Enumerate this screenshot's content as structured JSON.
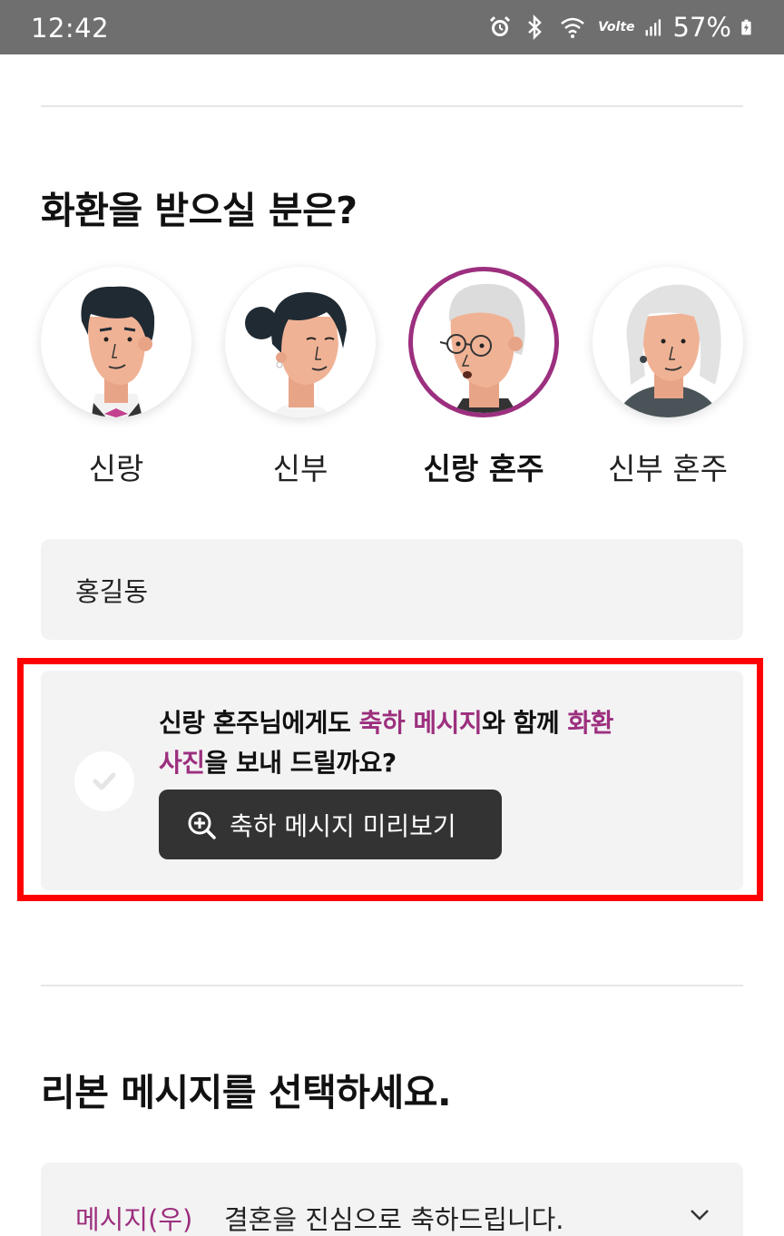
{
  "status_bar": {
    "time": "12:42",
    "volte": "Volte",
    "battery": "57%",
    "icons": [
      "alarm-icon",
      "bluetooth-icon",
      "wifi-icon",
      "volte-icon",
      "signal-icon",
      "battery-icon"
    ]
  },
  "recipient_section": {
    "title": "화환을 받으실 분은?",
    "options": [
      {
        "label": "신랑",
        "selected": false
      },
      {
        "label": "신부",
        "selected": false
      },
      {
        "label": "신랑 혼주",
        "selected": true
      },
      {
        "label": "신부 혼주",
        "selected": false
      }
    ]
  },
  "name_input": {
    "value": "홍길동"
  },
  "send_option": {
    "text_1": "신랑 혼주님에게도 ",
    "highlight_1": "축하 메시지",
    "text_2": "와 함께 ",
    "highlight_2": "화환",
    "highlight_3": "사진",
    "text_3": "을 보내 드릴까요?",
    "preview_button": "축하 메시지 미리보기",
    "checked": false
  },
  "ribbon_section": {
    "title": "리본 메시지를 선택하세요.",
    "tag": "메시지(우)",
    "message": "결혼을 진심으로 축하드립니다."
  },
  "colors": {
    "accent": "#9c2f7e",
    "status_bar": "#6f6f6f",
    "button_dark": "#333333",
    "field_bg": "#f3f3f3",
    "highlight_frame": "#ff0000"
  }
}
